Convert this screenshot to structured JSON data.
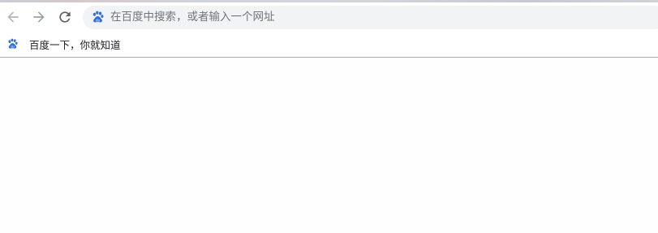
{
  "toolbar": {
    "back_icon": "arrow-left-icon",
    "forward_icon": "arrow-right-icon",
    "reload_icon": "reload-icon"
  },
  "omnibox": {
    "icon": "baidu-paw-icon",
    "placeholder": "在百度中搜索，或者输入一个网址",
    "value": ""
  },
  "bookmarks": {
    "items": [
      {
        "label": "百度一下，你就知道",
        "icon": "baidu-paw-icon"
      }
    ]
  },
  "colors": {
    "accent": "#2f6ee6",
    "icon_disabled": "#9aa0a6",
    "icon_active": "#5f6368",
    "omnibox_bg": "#f1f3f4"
  }
}
